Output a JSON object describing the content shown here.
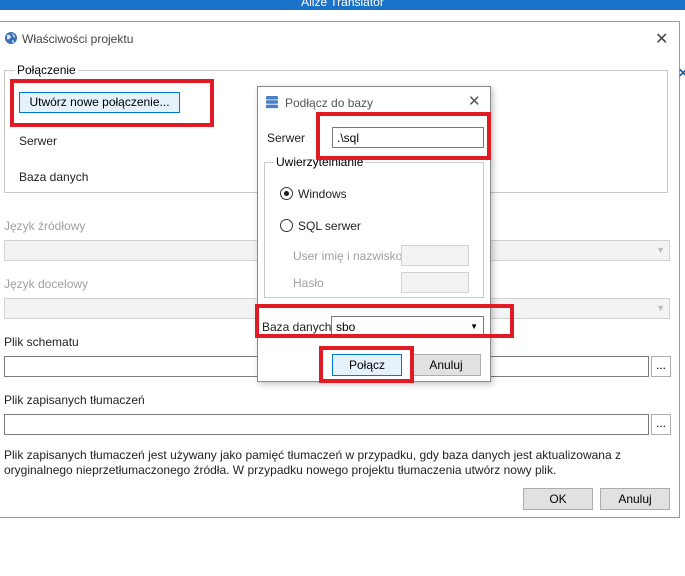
{
  "app": {
    "title": "Alize Translator"
  },
  "dialog": {
    "title": "Właściwości projektu",
    "connection_group": "Połączenie",
    "new_connection_button": "Utwórz nowe połączenie...",
    "server_label": "Serwer",
    "database_label": "Baza danych",
    "source_lang_label": "Język źródłowy",
    "target_lang_label": "Język docelowy",
    "schema_file_label": "Plik schematu",
    "schema_file_value": "",
    "saved_translations_label": "Plik zapisanych tłumaczeń",
    "saved_translations_value": "",
    "browse_label": "...",
    "info_text_line1": "Plik zapisanych tłumaczeń jest używany jako pamięć tłumaczeń w przypadku, gdy baza danych jest aktualizowana z",
    "info_text_line2": "oryginalnego nieprzetłumaczonego źródła. W przypadku nowego projektu tłumaczenia utwórz nowy plik.",
    "ok_button": "OK",
    "cancel_button": "Anuluj"
  },
  "connect_dialog": {
    "title": "Podłącz do bazy",
    "server_label": "Serwer",
    "server_value": ".\\sql",
    "auth_group": "Uwierzytelnianie",
    "windows_label": "Windows",
    "sql_label": "SQL serwer",
    "auth_selected": "Windows",
    "user_label": "User imię i nazwisko",
    "user_value": "",
    "password_label": "Hasło",
    "password_value": "",
    "database_label": "Baza danych",
    "database_value": "sbo",
    "connect_button": "Połącz",
    "cancel_button": "Anuluj"
  },
  "colors": {
    "highlight": "#e01b24",
    "titlebar": "#1a73c9",
    "focus_border": "#0078d7"
  }
}
